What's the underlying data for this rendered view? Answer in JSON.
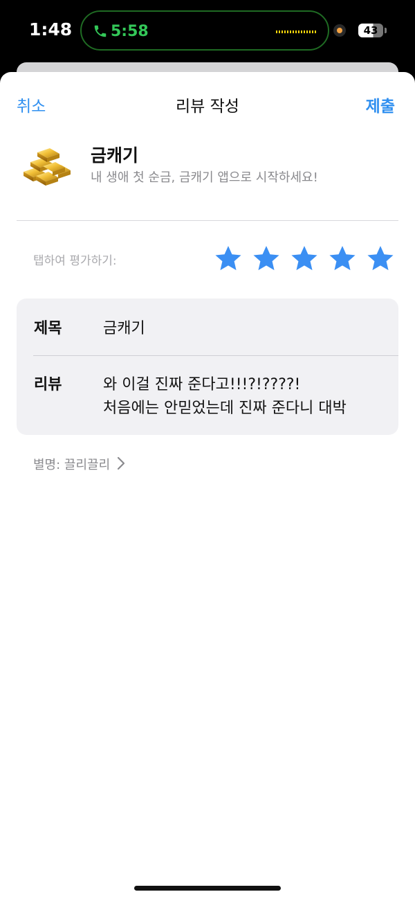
{
  "status_bar": {
    "time": "1:48",
    "call_timer": "5:58",
    "battery": "43",
    "icons": [
      "phone-icon",
      "waveform-icon",
      "recording-indicator-icon",
      "battery-icon"
    ]
  },
  "nav": {
    "cancel_label": "취소",
    "title": "리뷰 작성",
    "submit_label": "제출"
  },
  "app": {
    "name": "금캐기",
    "subtitle": "내 생애 첫 순금, 금캐기 앱으로 시작하세요!",
    "icon": "gold-bars-icon"
  },
  "rating": {
    "prompt": "탭하여 평가하기:",
    "value": 5,
    "max": 5,
    "star_color": "#3b8ff3"
  },
  "form": {
    "title_label": "제목",
    "title_value": "금캐기",
    "review_label": "리뷰",
    "review_lines": [
      "와 이걸 진짜 준다고!!!?!????!",
      "처음에는 안믿었는데 진짜 준다니 대박"
    ]
  },
  "nickname": {
    "text": "별명: 끌리끌리",
    "icon": "chevron-right-icon"
  },
  "colors": {
    "accent": "#2f8ff0",
    "card_bg": "#f1f1f4"
  }
}
